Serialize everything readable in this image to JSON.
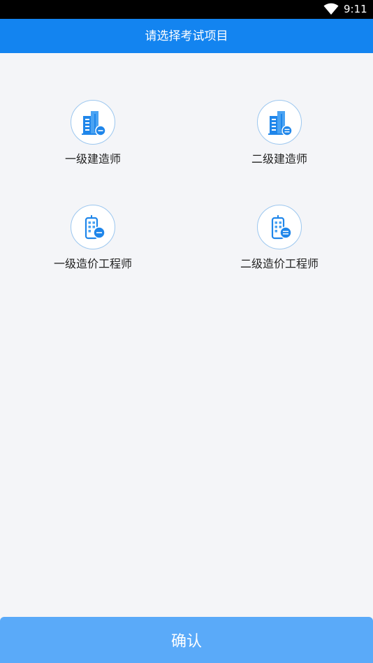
{
  "status_bar": {
    "time": "9:11",
    "icons": [
      "wifi-icon"
    ]
  },
  "header": {
    "title": "请选择考试项目"
  },
  "options": [
    {
      "label": "一级建造师",
      "icon": "building-icon"
    },
    {
      "label": "二级建造师",
      "icon": "building-icon"
    },
    {
      "label": "一级造价工程师",
      "icon": "office-building-icon"
    },
    {
      "label": "二级造价工程师",
      "icon": "office-building-icon"
    }
  ],
  "footer": {
    "confirm_label": "确认"
  },
  "colors": {
    "header_bg": "#1384f0",
    "confirm_bg": "#5aaaf9",
    "page_bg": "#f4f5f8",
    "icon_blue": "#1f86ea"
  }
}
